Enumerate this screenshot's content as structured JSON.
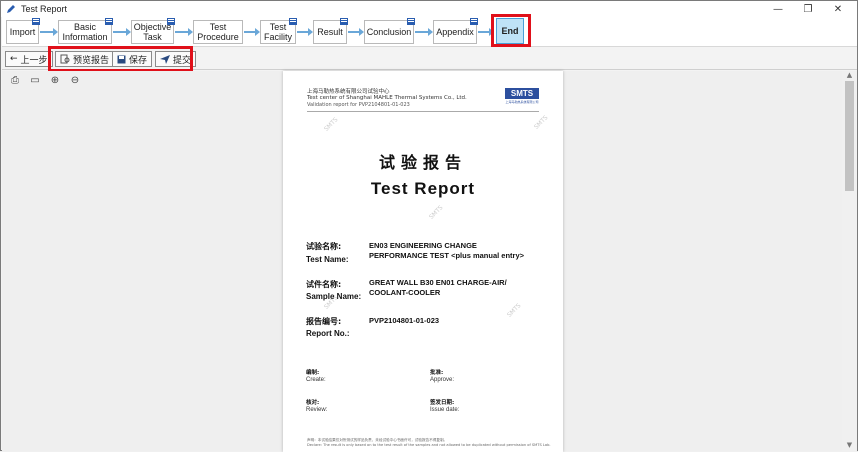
{
  "window": {
    "title": "Test Report",
    "controls": {
      "minimize": "—",
      "maximize": "❐",
      "close": "✕"
    }
  },
  "steps": [
    {
      "label": "Import",
      "active": false
    },
    {
      "label": "Basic\nInformation",
      "active": false
    },
    {
      "label": "Objective\nTask",
      "active": false
    },
    {
      "label": "Test\nProcedure",
      "active": false
    },
    {
      "label": "Test\nFacility",
      "active": false
    },
    {
      "label": "Result",
      "active": false
    },
    {
      "label": "Conclusion",
      "active": false
    },
    {
      "label": "Appendix",
      "active": false
    },
    {
      "label": "End",
      "active": true
    }
  ],
  "toolbar": {
    "back_label": "上一步",
    "preview_label": "预览报告",
    "save_label": "保存",
    "submit_label": "提交"
  },
  "colors": {
    "highlight": "#e0101a",
    "active_step": "#bfe3f7",
    "arrow": "#6aa7d8",
    "logo": "#2c4f9e"
  },
  "report": {
    "header_cn": "上海马勒热系统有限公司试验中心",
    "header_en": "Test center of Shanghai MAHLE Thermal Systems Co., Ltd.",
    "validation": "Validation report for PVP2104801-01-023",
    "logo_text": "SMTS",
    "logo_sub": "上海马勒热系统有限公司",
    "watermark": "SMTS",
    "title_cn": "试验报告",
    "title_en": "Test  Report",
    "test_name_cn": "试验名称:",
    "test_name_en": "Test Name:",
    "test_name_value1": "EN03 ENGINEERING CHANGE",
    "test_name_value2": "PERFORMANCE TEST <plus manual entry>",
    "sample_name_cn": "试件名称:",
    "sample_name_en": "Sample Name:",
    "sample_name_value1": "GREAT WALL B30 EN01 CHARGE-AIR/",
    "sample_name_value2": "COOLANT-COOLER",
    "report_no_cn": "报告编号:",
    "report_no_en": "Report No.:",
    "report_no_value": "PVP2104801-01-023",
    "create_cn": "编制:",
    "create_en": "Create:",
    "approve_cn": "批准:",
    "approve_en": "Approve:",
    "review_cn": "核对:",
    "review_en": "Review:",
    "issue_cn": "签发日期:",
    "issue_en": "Issue date:",
    "footer_cn": "声明：本试验结果仅对所测试的样品负责，未经试验中心书面许可，试验报告不得复制。",
    "footer_en": "Declare: The result is only based on to the test result of the samples and not allowed to be duplicated without permission of SMTS Lab."
  }
}
